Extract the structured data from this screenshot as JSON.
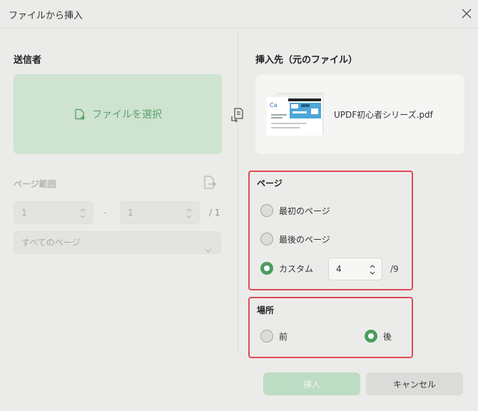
{
  "window": {
    "title": "ファイルから挿入"
  },
  "sender": {
    "heading": "送信者",
    "select_file_label": "ファイルを選択",
    "page_range": {
      "label": "ページ範囲",
      "from_value": "1",
      "separator": "-",
      "to_value": "1",
      "total": "/ 1",
      "preset": "すべてのページ"
    }
  },
  "destination": {
    "heading": "挿入先（元のファイル）",
    "file_name": "UPDF初心者シリーズ.pdf"
  },
  "page_group": {
    "heading": "ページ",
    "options": [
      {
        "label": "最初のページ",
        "selected": false
      },
      {
        "label": "最後のページ",
        "selected": false
      },
      {
        "label": "カスタム",
        "selected": true
      }
    ],
    "custom_value": "4",
    "total": "/9"
  },
  "location_group": {
    "heading": "場所",
    "options": [
      {
        "label": "前",
        "selected": false
      },
      {
        "label": "後",
        "selected": true
      }
    ]
  },
  "buttons": {
    "insert": "挿入",
    "cancel": "キャンセル"
  },
  "colors": {
    "accent": "#4a9c62",
    "highlight_border": "#e04a55",
    "drop_zone": "#cfe3d1"
  }
}
